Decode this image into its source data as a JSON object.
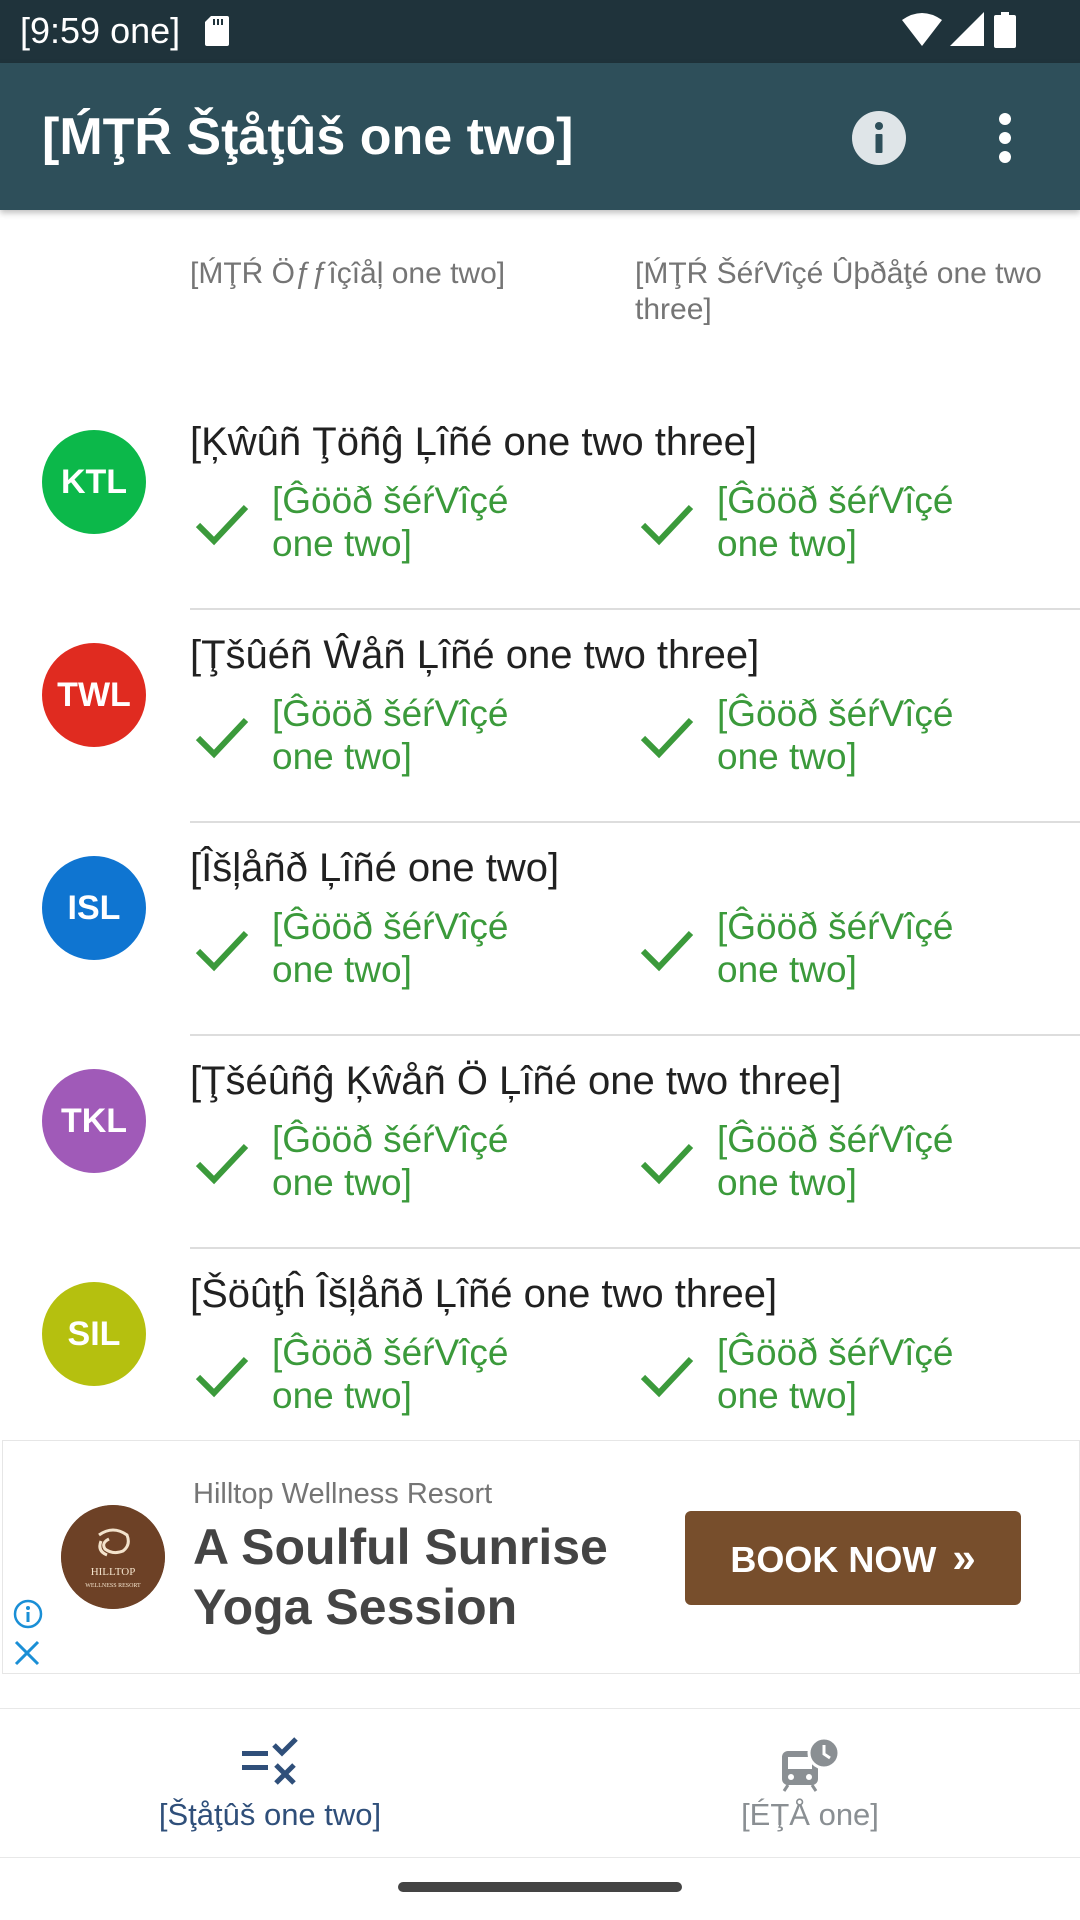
{
  "status_bar": {
    "time": "[9:59 one]"
  },
  "app_bar": {
    "title": "[ḾŢŔ Šţåţûš one two]"
  },
  "columns": {
    "official": "[ḾŢŔ Öƒƒîçîåļ one two]",
    "service_update": "[ḾŢŔ ŠéŕVîçé Ûþðåţé one two three]"
  },
  "lines": [
    {
      "abbr": "KTL",
      "color": "#0cb84a",
      "name": "[Ķŵûñ Ţöñĝ Ļîñé one two three]",
      "official_status": "[Ĝööð šéŕVîçé one two]",
      "update_status": "[Ĝööð šéŕVîçé one two]"
    },
    {
      "abbr": "TWL",
      "color": "#e02b20",
      "name": "[Ţšûéñ Ŵåñ Ļîñé one two three]",
      "official_status": "[Ĝööð šéŕVîçé one two]",
      "update_status": "[Ĝööð šéŕVîçé one two]"
    },
    {
      "abbr": "ISL",
      "color": "#0f75d1",
      "name": "[Îšļåñð Ļîñé one two]",
      "official_status": "[Ĝööð šéŕVîçé one two]",
      "update_status": "[Ĝööð šéŕVîçé one two]"
    },
    {
      "abbr": "TKL",
      "color": "#a05ab8",
      "name": "[Ţšéûñĝ Ķŵåñ Ö Ļîñé one two three]",
      "official_status": "[Ĝööð šéŕVîçé one two]",
      "update_status": "[Ĝööð šéŕVîçé one two]"
    },
    {
      "abbr": "SIL",
      "color": "#b5c00f",
      "name": "[Šöûţĥ Îšļåñð Ļîñé one two three]",
      "official_status": "[Ĝööð šéŕVîçé one two]",
      "update_status": "[Ĝööð šéŕVîçé one two]"
    }
  ],
  "ad": {
    "logo_text": "HILLTOP",
    "logo_subtext": "WELLNESS RESORT",
    "advertiser": "Hilltop Wellness Resort",
    "headline": "A Soulful Sunrise Yoga Session",
    "cta": "BOOK NOW"
  },
  "bottom_nav": {
    "status_label": "[Šţåţûš one two]",
    "eta_label": "[ÉŢÅ one]"
  },
  "icons": {
    "status_good": "check-icon",
    "info": "info-icon",
    "more": "more-vert-icon"
  },
  "theme": {
    "app_bar": "#2e4f5a",
    "status_bar": "#1f333b",
    "good_service": "#3b9a3b"
  }
}
